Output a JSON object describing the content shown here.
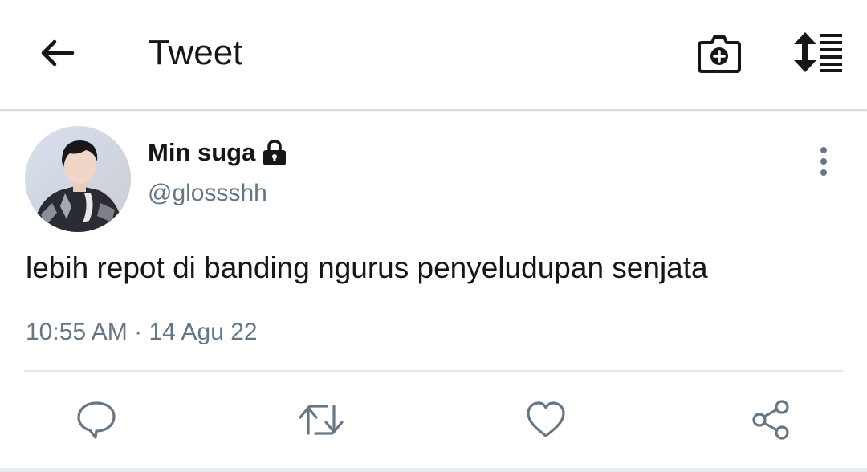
{
  "header": {
    "title": "Tweet"
  },
  "tweet": {
    "author_name": "Min suga",
    "handle": "@glossshh",
    "text": "lebih repot di banding ngurus penyeludupan senjata",
    "time": "10:55 AM",
    "separator": "·",
    "date": "14 Agu 22"
  },
  "icons": {
    "back": "arrow-left-icon",
    "camera": "camera-plus-icon",
    "sort": "sort-list-icon",
    "lock": "lock-icon",
    "more": "more-vertical-icon",
    "reply": "reply-icon",
    "retweet": "retweet-icon",
    "like": "heart-icon",
    "share": "share-icon"
  },
  "colors": {
    "text": "#14171a",
    "secondary": "#657786",
    "divider": "#e1e6ea"
  }
}
